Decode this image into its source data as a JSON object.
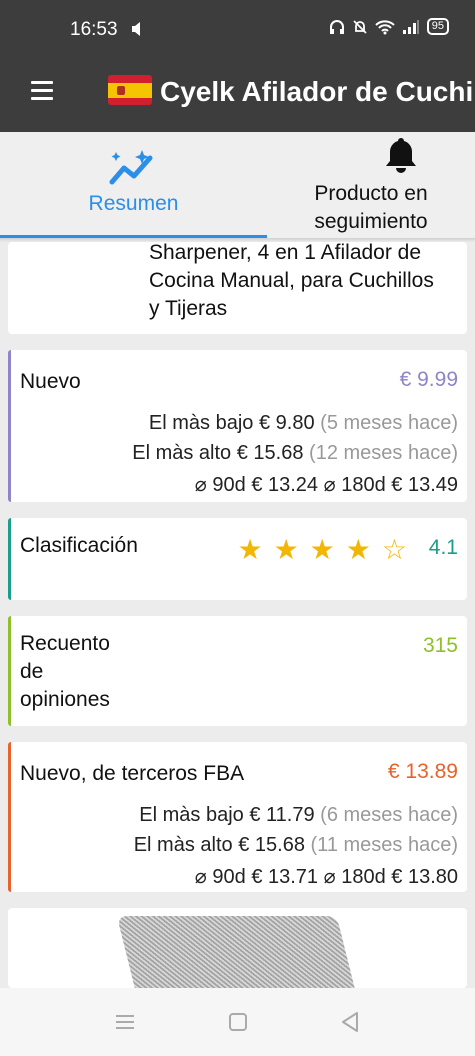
{
  "status_bar": {
    "time": "16:53",
    "battery": "95",
    "icons": [
      "sound-icon",
      "headphones-icon",
      "mute-icon",
      "wifi-icon",
      "signal-icon",
      "battery-icon"
    ]
  },
  "app_bar": {
    "title": "Cyelk Afilador de Cuchi",
    "menu_icon": "menu-icon",
    "flag": "spain-flag-icon"
  },
  "tabs": [
    {
      "label": "Resumen",
      "icon": "trend-sparkle-icon",
      "active": true
    },
    {
      "label": "Producto en seguimiento",
      "icon": "bell-icon",
      "active": false
    }
  ],
  "product": {
    "title": "Sharpener, 4 en 1 Afilador de Cocina Manual, para Cuchillos y Tijeras"
  },
  "cards": {
    "nuevo": {
      "label": "Nuevo",
      "price": "€ 9.99",
      "accent": "#8f84c9",
      "lowest": {
        "label": "El màs bajo",
        "value": "€ 9.80",
        "when": "(5 meses hace)"
      },
      "highest": {
        "label": "El màs alto",
        "value": "€ 15.68",
        "when": "(12 meses hace)"
      },
      "avg90_label": "⌀ 90d",
      "avg90": "€ 13.24",
      "avg180_label": "⌀ 180d",
      "avg180": "€ 13.49"
    },
    "rating": {
      "label": "Clasificación",
      "value": "4.1",
      "stars_filled": 4,
      "stars_total": 5,
      "accent": "#1a9e8a"
    },
    "reviews": {
      "label": "Recuento de opiniones",
      "value": "315",
      "accent": "#8fbf2a"
    },
    "fba": {
      "label": "Nuevo, de terceros FBA",
      "price": "€ 13.89",
      "accent": "#e8622c",
      "lowest": {
        "label": "El màs bajo",
        "value": "€ 11.79",
        "when": "(6 meses hace)"
      },
      "highest": {
        "label": "El màs alto",
        "value": "€ 15.68",
        "when": "(11 meses hace)"
      },
      "avg90_label": "⌀ 90d",
      "avg90": "€ 13.71",
      "avg180_label": "⌀ 180d",
      "avg180": "€ 13.80"
    }
  },
  "nav_bar": [
    "recents-icon",
    "home-icon",
    "back-icon"
  ]
}
